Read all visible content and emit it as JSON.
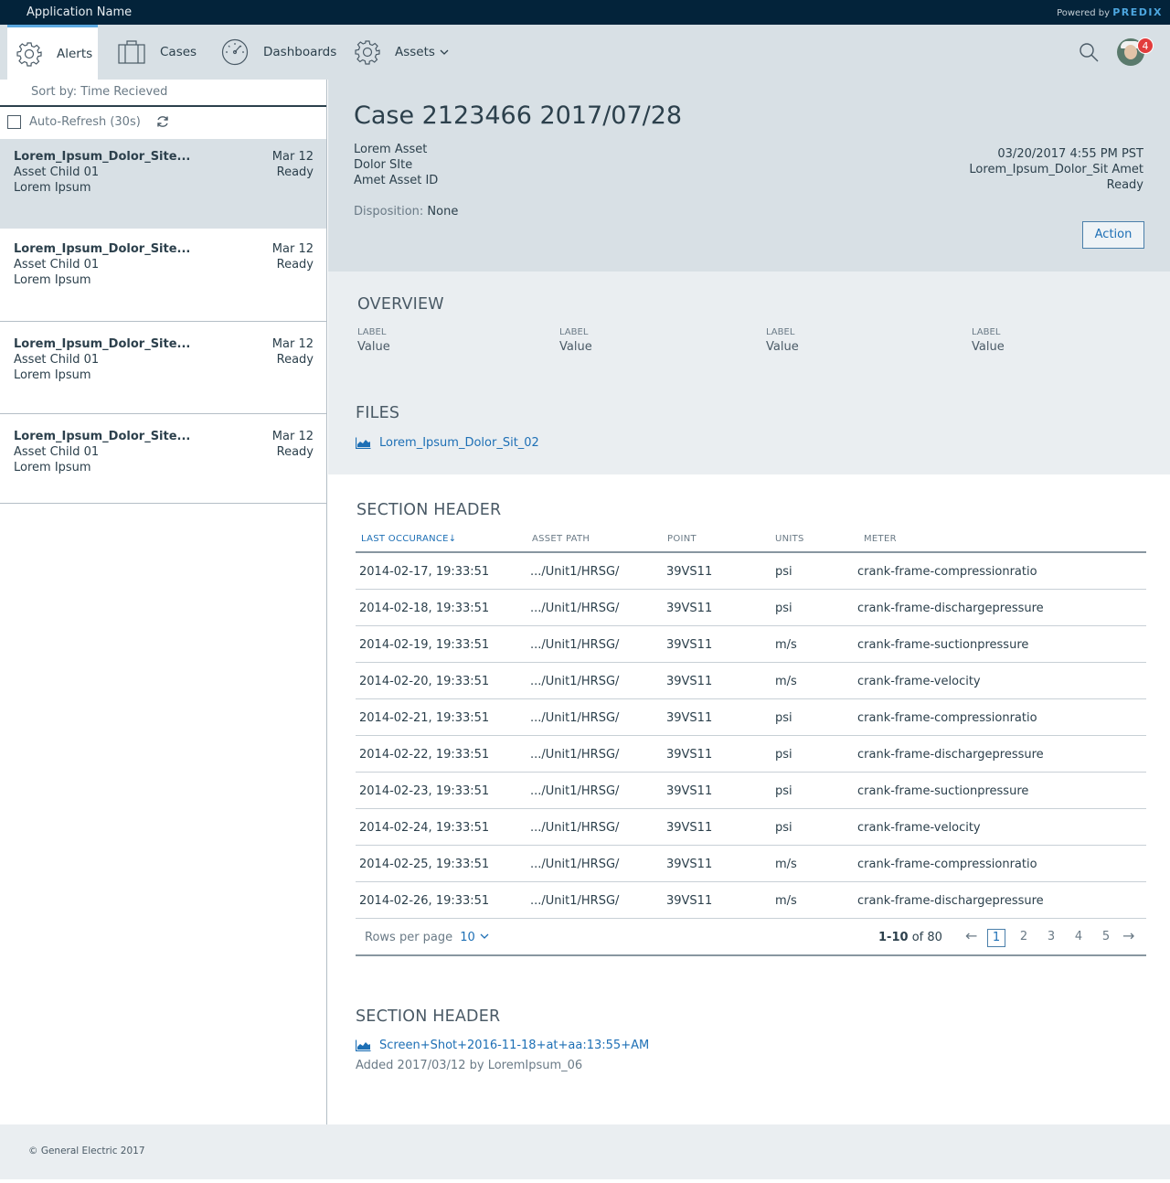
{
  "app": {
    "name": "Application Name",
    "powered_by": "Powered by",
    "brand": "PREDIX"
  },
  "nav": {
    "items": [
      {
        "label": "Alerts",
        "icon": "gear-icon",
        "active": true
      },
      {
        "label": "Cases",
        "icon": "briefcase-icon",
        "active": false
      },
      {
        "label": "Dashboards",
        "icon": "gauge-icon",
        "active": false
      },
      {
        "label": "Assets",
        "icon": "gear-icon",
        "active": false
      }
    ],
    "notification_count": "4"
  },
  "sidebar": {
    "sort_label": "Sort by: Time Recieved",
    "auto_refresh": "Auto-Refresh (30s)",
    "alerts": [
      {
        "title": "Lorem_Ipsum_Dolor_Site...",
        "sub1": "Asset Child 01",
        "sub2": "Lorem Ipsum",
        "date": "Mar 12",
        "status": "Ready"
      },
      {
        "title": "Lorem_Ipsum_Dolor_Site...",
        "sub1": "Asset Child 01",
        "sub2": "Lorem Ipsum",
        "date": "Mar 12",
        "status": "Ready"
      },
      {
        "title": "Lorem_Ipsum_Dolor_Site...",
        "sub1": "Asset Child 01",
        "sub2": "Lorem Ipsum",
        "date": "Mar 12",
        "status": "Ready"
      },
      {
        "title": "Lorem_Ipsum_Dolor_Site...",
        "sub1": "Asset Child 01",
        "sub2": "Lorem Ipsum",
        "date": "Mar 12",
        "status": "Ready"
      }
    ]
  },
  "case": {
    "title": "Case 2123466 2017/07/28",
    "asset": "Lorem Asset",
    "site": "Dolor SIte",
    "asset_id": "Amet Asset ID",
    "timestamp": "03/20/2017 4:55 PM PST",
    "owner": "Lorem_Ipsum_Dolor_Sit Amet",
    "status": "Ready",
    "disposition_label": "Disposition:",
    "disposition_value": "None",
    "action_label": "Action"
  },
  "overview": {
    "title": "OVERVIEW",
    "fields": [
      {
        "label": "LABEL",
        "value": "Value"
      },
      {
        "label": "LABEL",
        "value": "Value"
      },
      {
        "label": "LABEL",
        "value": "Value"
      },
      {
        "label": "LABEL",
        "value": "Value"
      }
    ]
  },
  "files": {
    "title": "FILES",
    "link": "Lorem_Ipsum_Dolor_Sit_02"
  },
  "table_section": {
    "title": "SECTION HEADER",
    "columns": [
      "LAST OCCURANCE↓",
      "ASSET PATH",
      "POINT",
      "UNITS",
      "METER"
    ],
    "rows": [
      [
        "2014-02-17, 19:33:51",
        ".../Unit1/HRSG/",
        "39VS11",
        "psi",
        "crank-frame-compressionratio"
      ],
      [
        "2014-02-18, 19:33:51",
        ".../Unit1/HRSG/",
        "39VS11",
        "psi",
        "crank-frame-dischargepressure"
      ],
      [
        "2014-02-19, 19:33:51",
        ".../Unit1/HRSG/",
        "39VS11",
        "m/s",
        "crank-frame-suctionpressure"
      ],
      [
        "2014-02-20, 19:33:51",
        ".../Unit1/HRSG/",
        "39VS11",
        "m/s",
        "crank-frame-velocity"
      ],
      [
        "2014-02-21, 19:33:51",
        ".../Unit1/HRSG/",
        "39VS11",
        "psi",
        "crank-frame-compressionratio"
      ],
      [
        "2014-02-22, 19:33:51",
        ".../Unit1/HRSG/",
        "39VS11",
        "psi",
        "crank-frame-dischargepressure"
      ],
      [
        "2014-02-23, 19:33:51",
        ".../Unit1/HRSG/",
        "39VS11",
        "psi",
        "crank-frame-suctionpressure"
      ],
      [
        "2014-02-24, 19:33:51",
        ".../Unit1/HRSG/",
        "39VS11",
        "psi",
        "crank-frame-velocity"
      ],
      [
        "2014-02-25, 19:33:51",
        ".../Unit1/HRSG/",
        "39VS11",
        "m/s",
        "crank-frame-compressionratio"
      ],
      [
        "2014-02-26, 19:33:51",
        ".../Unit1/HRSG/",
        "39VS11",
        "m/s",
        "crank-frame-dischargepressure"
      ]
    ],
    "rows_per_page_label": "Rows per page",
    "rows_per_page_value": "10",
    "range": "1-10",
    "range_of": "of 80",
    "pages": [
      "1",
      "2",
      "3",
      "4",
      "5"
    ],
    "prev_arrow": "←",
    "next_arrow": "→"
  },
  "attachments": {
    "title": "SECTION HEADER",
    "link": "Screen+Shot+2016-11-18+at+aa:13:55+AM",
    "added": "Added 2017/03/12 by LoremIpsum_06"
  },
  "footer": {
    "copyright": "© General Electric 2017"
  }
}
